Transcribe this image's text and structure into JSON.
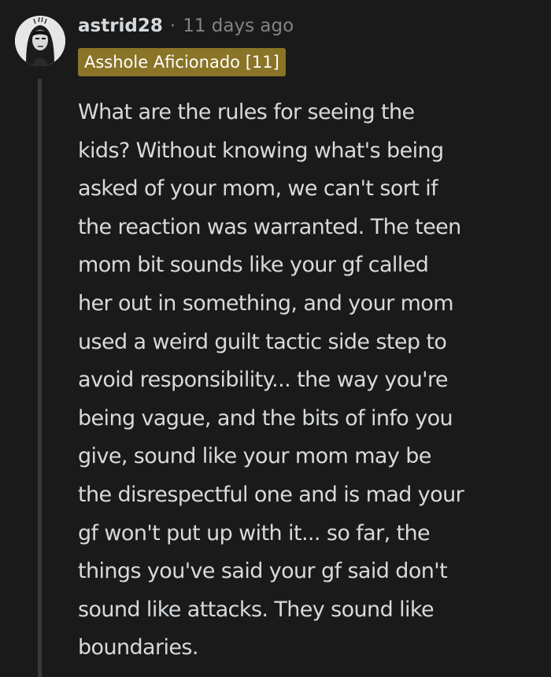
{
  "comment": {
    "avatar_icon": "user-avatar",
    "username": "astrid28",
    "separator": "·",
    "timestamp": "11 days ago",
    "flair": {
      "text": "Asshole Aficionado [11]",
      "background": "#8a7427"
    },
    "body_lines": [
      "What are the rules for seeing the",
      "kids? Without knowing what's being",
      "asked of your mom, we can't sort if",
      "the reaction was warranted. The teen",
      "mom bit sounds like your gf called",
      "her out in something, and your mom",
      "used a weird guilt tactic side step to",
      "avoid responsibility... the way you're",
      "being vague, and the bits of info you",
      "give, sound like your mom may be",
      "the disrespectful one and is mad your",
      "gf won't put up with it... so far, the",
      "things you've said your gf said don't",
      "sound like attacks. They sound like",
      "boundaries."
    ]
  },
  "colors": {
    "background": "#1a1a1b",
    "text": "#d7dadc",
    "muted": "#818384",
    "thread_line": "#3a3a3c"
  }
}
